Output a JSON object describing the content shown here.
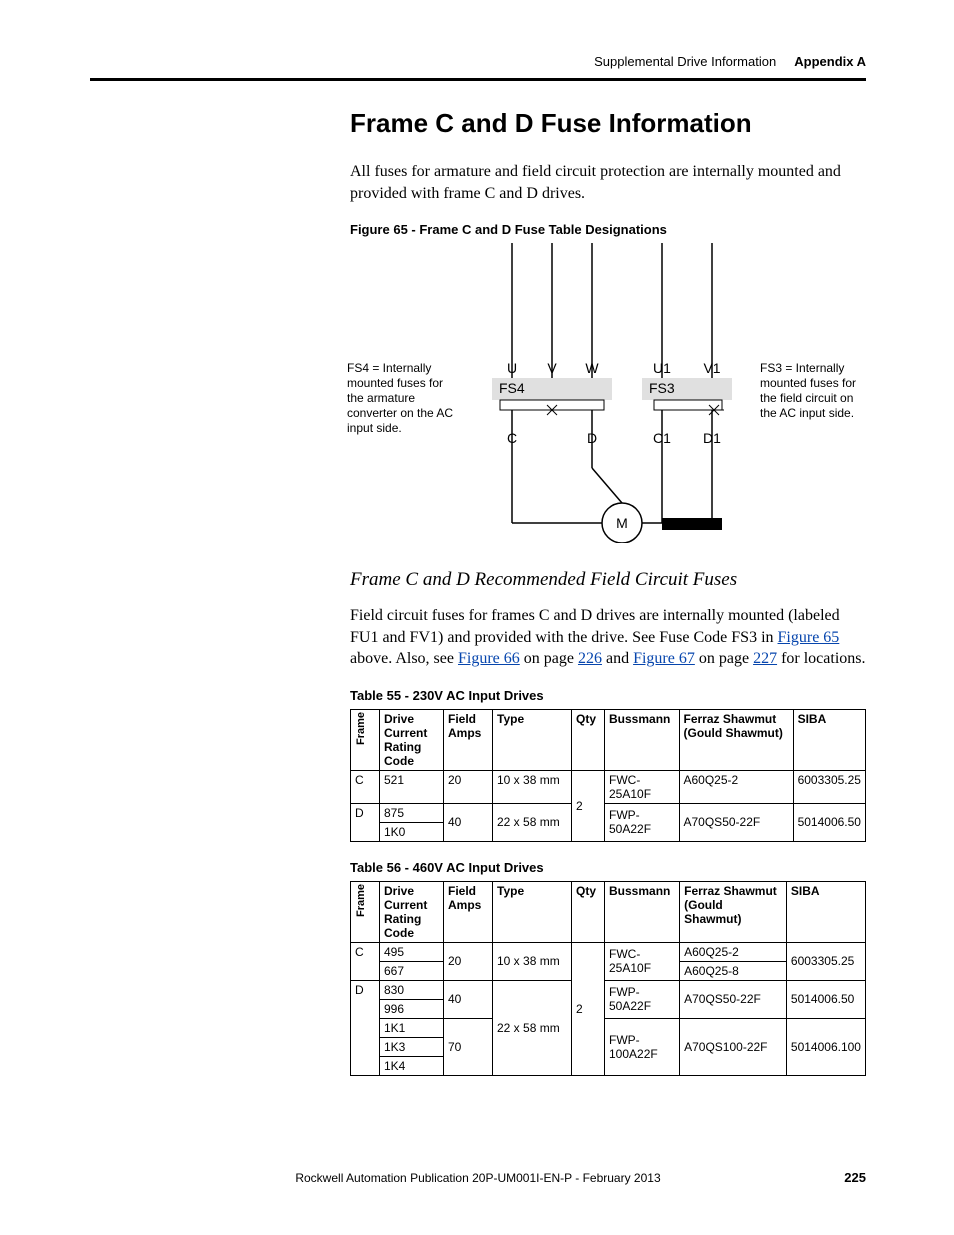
{
  "header": {
    "section": "Supplemental Drive Information",
    "appendix": "Appendix A"
  },
  "heading": "Frame C and D Fuse Information",
  "intro": "All fuses for armature and field circuit protection are internally mounted and provided with frame C and D drives.",
  "figure65": {
    "caption": "Figure 65 - Frame C and D Fuse Table Designations",
    "left_note": "FS4 = Internally mounted fuses for the armature converter on the AC input side.",
    "right_note": "FS3 = Internally mounted fuses for the field circuit on the AC input side.",
    "labels": {
      "U": "U",
      "V": "V",
      "W": "W",
      "U1": "U1",
      "V1": "V1",
      "FS4": "FS4",
      "FS3": "FS3",
      "C": "C",
      "D": "D",
      "C1": "C1",
      "D1": "D1",
      "M": "M"
    }
  },
  "subhead": "Frame C and D Recommended Field Circuit Fuses",
  "para2_a": "Field circuit fuses for frames C and D drives are internally mounted (labeled FU1 and FV1) and provided with the drive. See Fuse Code FS3 in ",
  "para2_link1": "Figure 65",
  "para2_b": " above. Also, see ",
  "para2_link2": "Figure 66",
  "para2_c": " on page ",
  "para2_link3": "226",
  "para2_d": " and ",
  "para2_link4": "Figure 67",
  "para2_e": " on page ",
  "para2_link5": "227",
  "para2_f": " for locations.",
  "table55": {
    "caption": "Table 55 - 230V AC Input Drives",
    "headers": {
      "frame": "Frame",
      "code": "Drive Current Rating Code",
      "field": "Field Amps",
      "type": "Type",
      "qty": "Qty",
      "buss": "Bussmann",
      "ferraz": "Ferraz Shawmut (Gould Shawmut)",
      "siba": "SIBA"
    },
    "rows": [
      {
        "frame": "C",
        "code": "521",
        "field": "20",
        "type": "10 x 38 mm",
        "qty": "2",
        "buss": "FWC-25A10F",
        "ferraz": "A60Q25-2",
        "siba": "6003305.25"
      },
      {
        "frame": "D",
        "code": "875",
        "field": "40",
        "type": "22 x 58 mm",
        "qty": "",
        "buss": "FWP-50A22F",
        "ferraz": "A70QS50-22F",
        "siba": "5014006.50"
      },
      {
        "frame": "",
        "code": "1K0",
        "field": "",
        "type": "",
        "qty": "",
        "buss": "",
        "ferraz": "",
        "siba": ""
      }
    ]
  },
  "table56": {
    "caption": "Table 56 - 460V AC Input Drives",
    "headers": {
      "frame": "Frame",
      "code": "Drive Current Rating Code",
      "field": "Field Amps",
      "type": "Type",
      "qty": "Qty",
      "buss": "Bussmann",
      "ferraz": "Ferraz Shawmut (Gould Shawmut)",
      "siba": "SIBA"
    },
    "rows": [
      {
        "frame": "C",
        "code": "495",
        "field": "20",
        "type": "10 x 38 mm",
        "qty": "2",
        "buss": "FWC-25A10F",
        "ferraz": "A60Q25-2",
        "siba": "6003305.25"
      },
      {
        "frame": "",
        "code": "667",
        "field": "",
        "type": "",
        "qty": "",
        "buss": "",
        "ferraz": "A60Q25-8",
        "siba": ""
      },
      {
        "frame": "D",
        "code": "830",
        "field": "40",
        "type": "22 x 58 mm",
        "qty": "",
        "buss": "FWP-50A22F",
        "ferraz": "A70QS50-22F",
        "siba": "5014006.50"
      },
      {
        "frame": "",
        "code": "996",
        "field": "",
        "type": "",
        "qty": "",
        "buss": "",
        "ferraz": "",
        "siba": ""
      },
      {
        "frame": "",
        "code": "1K1",
        "field": "70",
        "type": "",
        "qty": "",
        "buss": "FWP-100A22F",
        "ferraz": "A70QS100-22F",
        "siba": "5014006.100"
      },
      {
        "frame": "",
        "code": "1K3",
        "field": "",
        "type": "",
        "qty": "",
        "buss": "",
        "ferraz": "",
        "siba": ""
      },
      {
        "frame": "",
        "code": "1K4",
        "field": "",
        "type": "",
        "qty": "",
        "buss": "",
        "ferraz": "",
        "siba": ""
      }
    ]
  },
  "footer": {
    "pub": "Rockwell Automation Publication 20P-UM001I-EN-P - February 2013",
    "page": "225"
  }
}
